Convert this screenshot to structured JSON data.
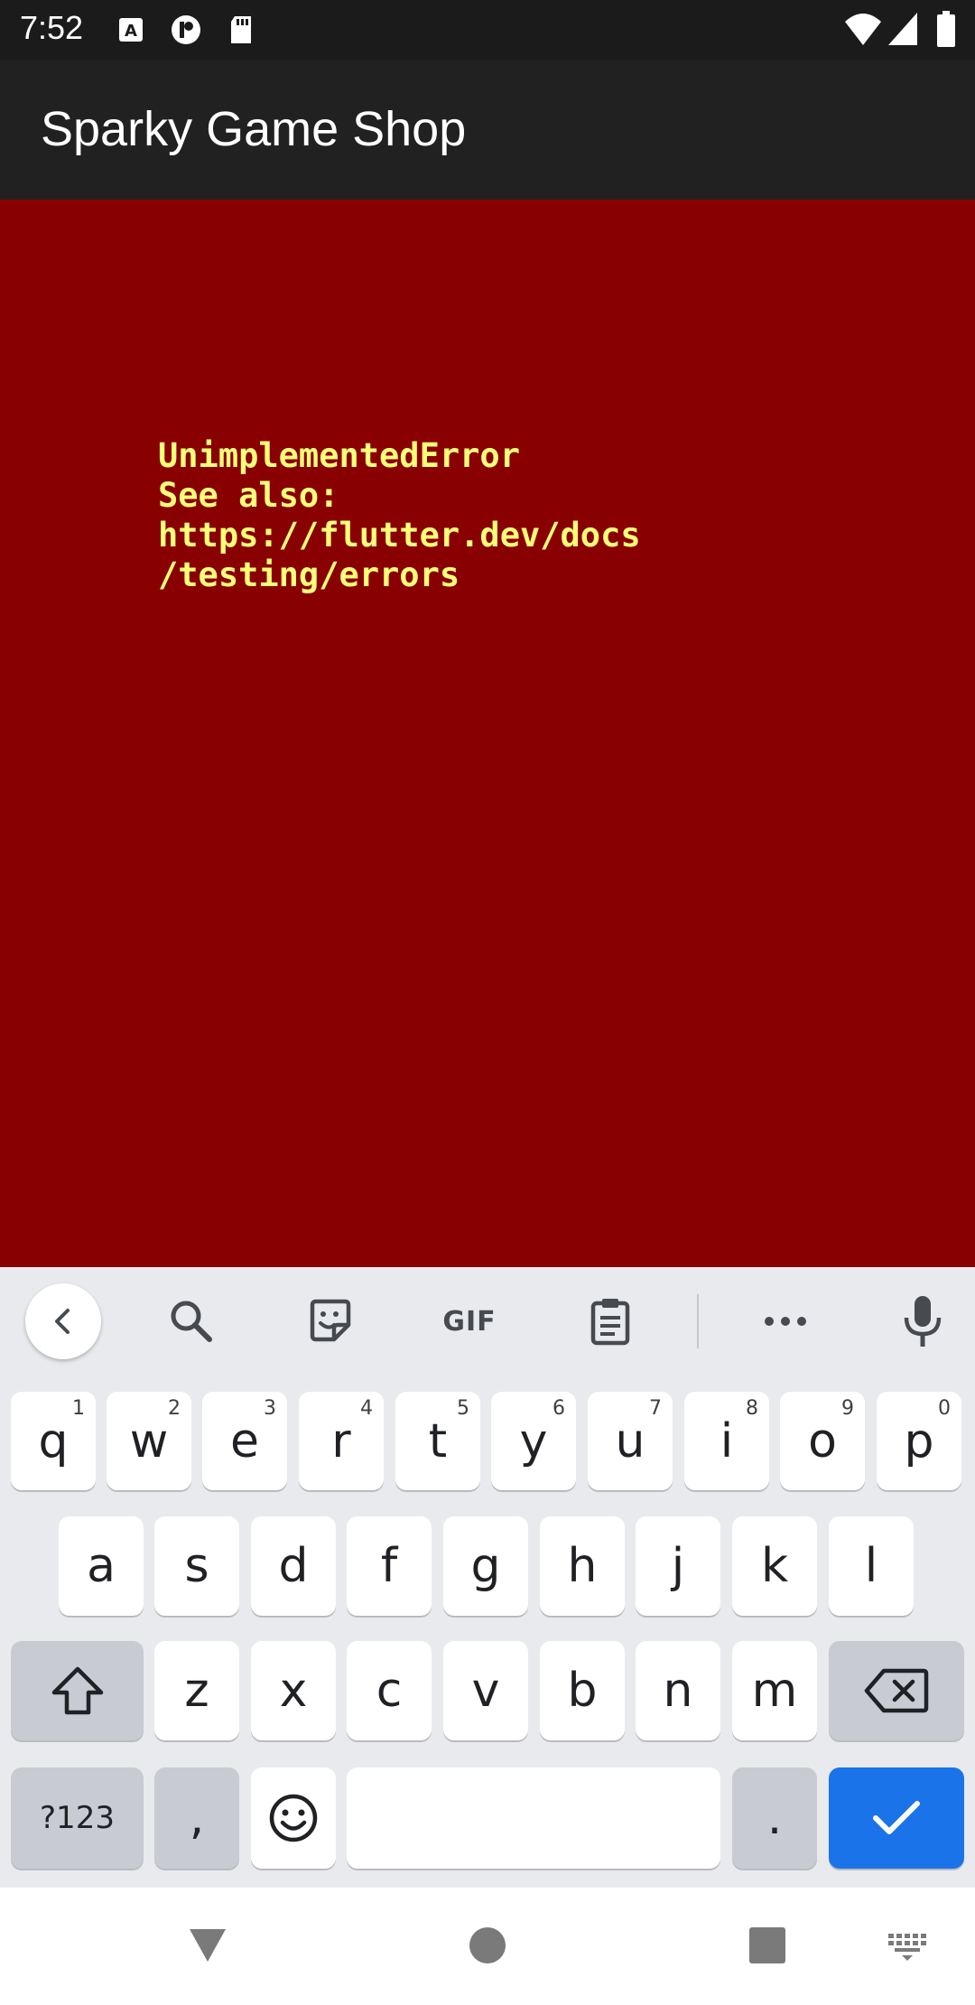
{
  "status_bar": {
    "time": "7:52",
    "left_icons": [
      "a-notification-icon",
      "p-notification-icon",
      "sd-card-icon"
    ],
    "right_icons": [
      "wifi-icon",
      "signal-icon",
      "battery-icon"
    ]
  },
  "app_bar": {
    "title": "Sparky Game Shop"
  },
  "error": {
    "line1": "UnimplementedError",
    "line2": "See also:",
    "line3": "https://flutter.dev/docs",
    "line4": "/testing/errors"
  },
  "keyboard": {
    "toolbar": {
      "items": [
        "back-icon",
        "search-icon",
        "sticker-icon",
        "gif",
        "clipboard-icon",
        "more-icon",
        "mic-icon"
      ],
      "gif_label": "GIF"
    },
    "row1": [
      {
        "key": "q",
        "hint": "1"
      },
      {
        "key": "w",
        "hint": "2"
      },
      {
        "key": "e",
        "hint": "3"
      },
      {
        "key": "r",
        "hint": "4"
      },
      {
        "key": "t",
        "hint": "5"
      },
      {
        "key": "y",
        "hint": "6"
      },
      {
        "key": "u",
        "hint": "7"
      },
      {
        "key": "i",
        "hint": "8"
      },
      {
        "key": "o",
        "hint": "9"
      },
      {
        "key": "p",
        "hint": "0"
      }
    ],
    "row2": [
      "a",
      "s",
      "d",
      "f",
      "g",
      "h",
      "j",
      "k",
      "l"
    ],
    "row3": [
      "z",
      "x",
      "c",
      "v",
      "b",
      "n",
      "m"
    ],
    "row4": {
      "symbols": "?123",
      "comma": ",",
      "period": "."
    }
  },
  "colors": {
    "error_background": "#880000",
    "error_text": "#ffff79",
    "app_bar": "#212121",
    "enter_key": "#1a73e8"
  }
}
